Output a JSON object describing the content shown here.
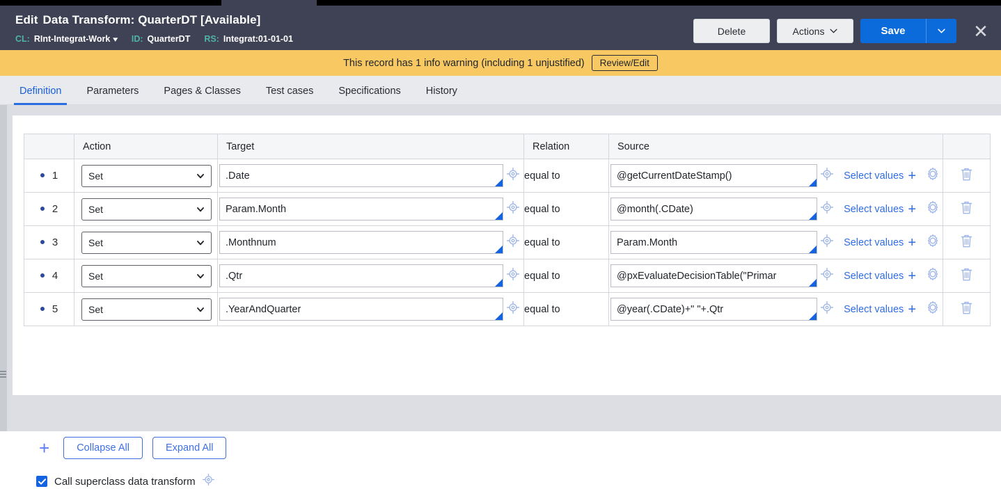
{
  "window": {
    "strip_color": "#000000",
    "tab_color": "#3f4254"
  },
  "header": {
    "lead": "Edit",
    "title": "Data Transform: QuarterDT [Available]",
    "meta": [
      {
        "label": "CL:",
        "value": "RInt-Integrat-Work",
        "has_caret": true
      },
      {
        "label": "ID:",
        "value": "QuarterDT",
        "has_caret": false
      },
      {
        "label": "RS:",
        "value": "Integrat:01-01-01",
        "has_caret": false
      }
    ],
    "delete_label": "Delete",
    "actions_label": "Actions",
    "save_label": "Save",
    "close_icon": "close-icon",
    "accent_color": "#0b6bdb",
    "bg_color": "#3f4254",
    "label_color": "#4fb3a5"
  },
  "banner": {
    "message": "This record has 1 info warning (including 1 unjustified)",
    "button_label": "Review/Edit",
    "bg_color": "#f8c963"
  },
  "tabs": [
    {
      "label": "Definition",
      "active": true
    },
    {
      "label": "Parameters",
      "active": false
    },
    {
      "label": "Pages & Classes",
      "active": false
    },
    {
      "label": "Test cases",
      "active": false
    },
    {
      "label": "Specifications",
      "active": false
    },
    {
      "label": "History",
      "active": false
    }
  ],
  "table": {
    "columns": [
      "",
      "Action",
      "Target",
      "Relation",
      "Source",
      ""
    ],
    "rows": [
      {
        "num": "1",
        "action": "Set",
        "target": ".Date",
        "relation": "equal to",
        "source": "@getCurrentDateStamp()",
        "select_values": "Select values"
      },
      {
        "num": "2",
        "action": "Set",
        "target": "Param.Month",
        "relation": "equal to",
        "source": "@month(.CDate)",
        "select_values": "Select values"
      },
      {
        "num": "3",
        "action": "Set",
        "target": ".Monthnum",
        "relation": "equal to",
        "source": "Param.Month",
        "select_values": "Select values"
      },
      {
        "num": "4",
        "action": "Set",
        "target": ".Qtr",
        "relation": "equal to",
        "source": "@pxEvaluateDecisionTable(\"Primar",
        "select_values": "Select values"
      },
      {
        "num": "5",
        "action": "Set",
        "target": ".YearAndQuarter",
        "relation": "equal to",
        "source": "@year(.CDate)+\" \"+.Qtr",
        "select_values": "Select values"
      }
    ]
  },
  "toolbar": {
    "add_icon": "plus-icon",
    "collapse_all_label": "Collapse All",
    "expand_all_label": "Expand All"
  },
  "superclass": {
    "checked": true,
    "label": "Call superclass data transform"
  }
}
